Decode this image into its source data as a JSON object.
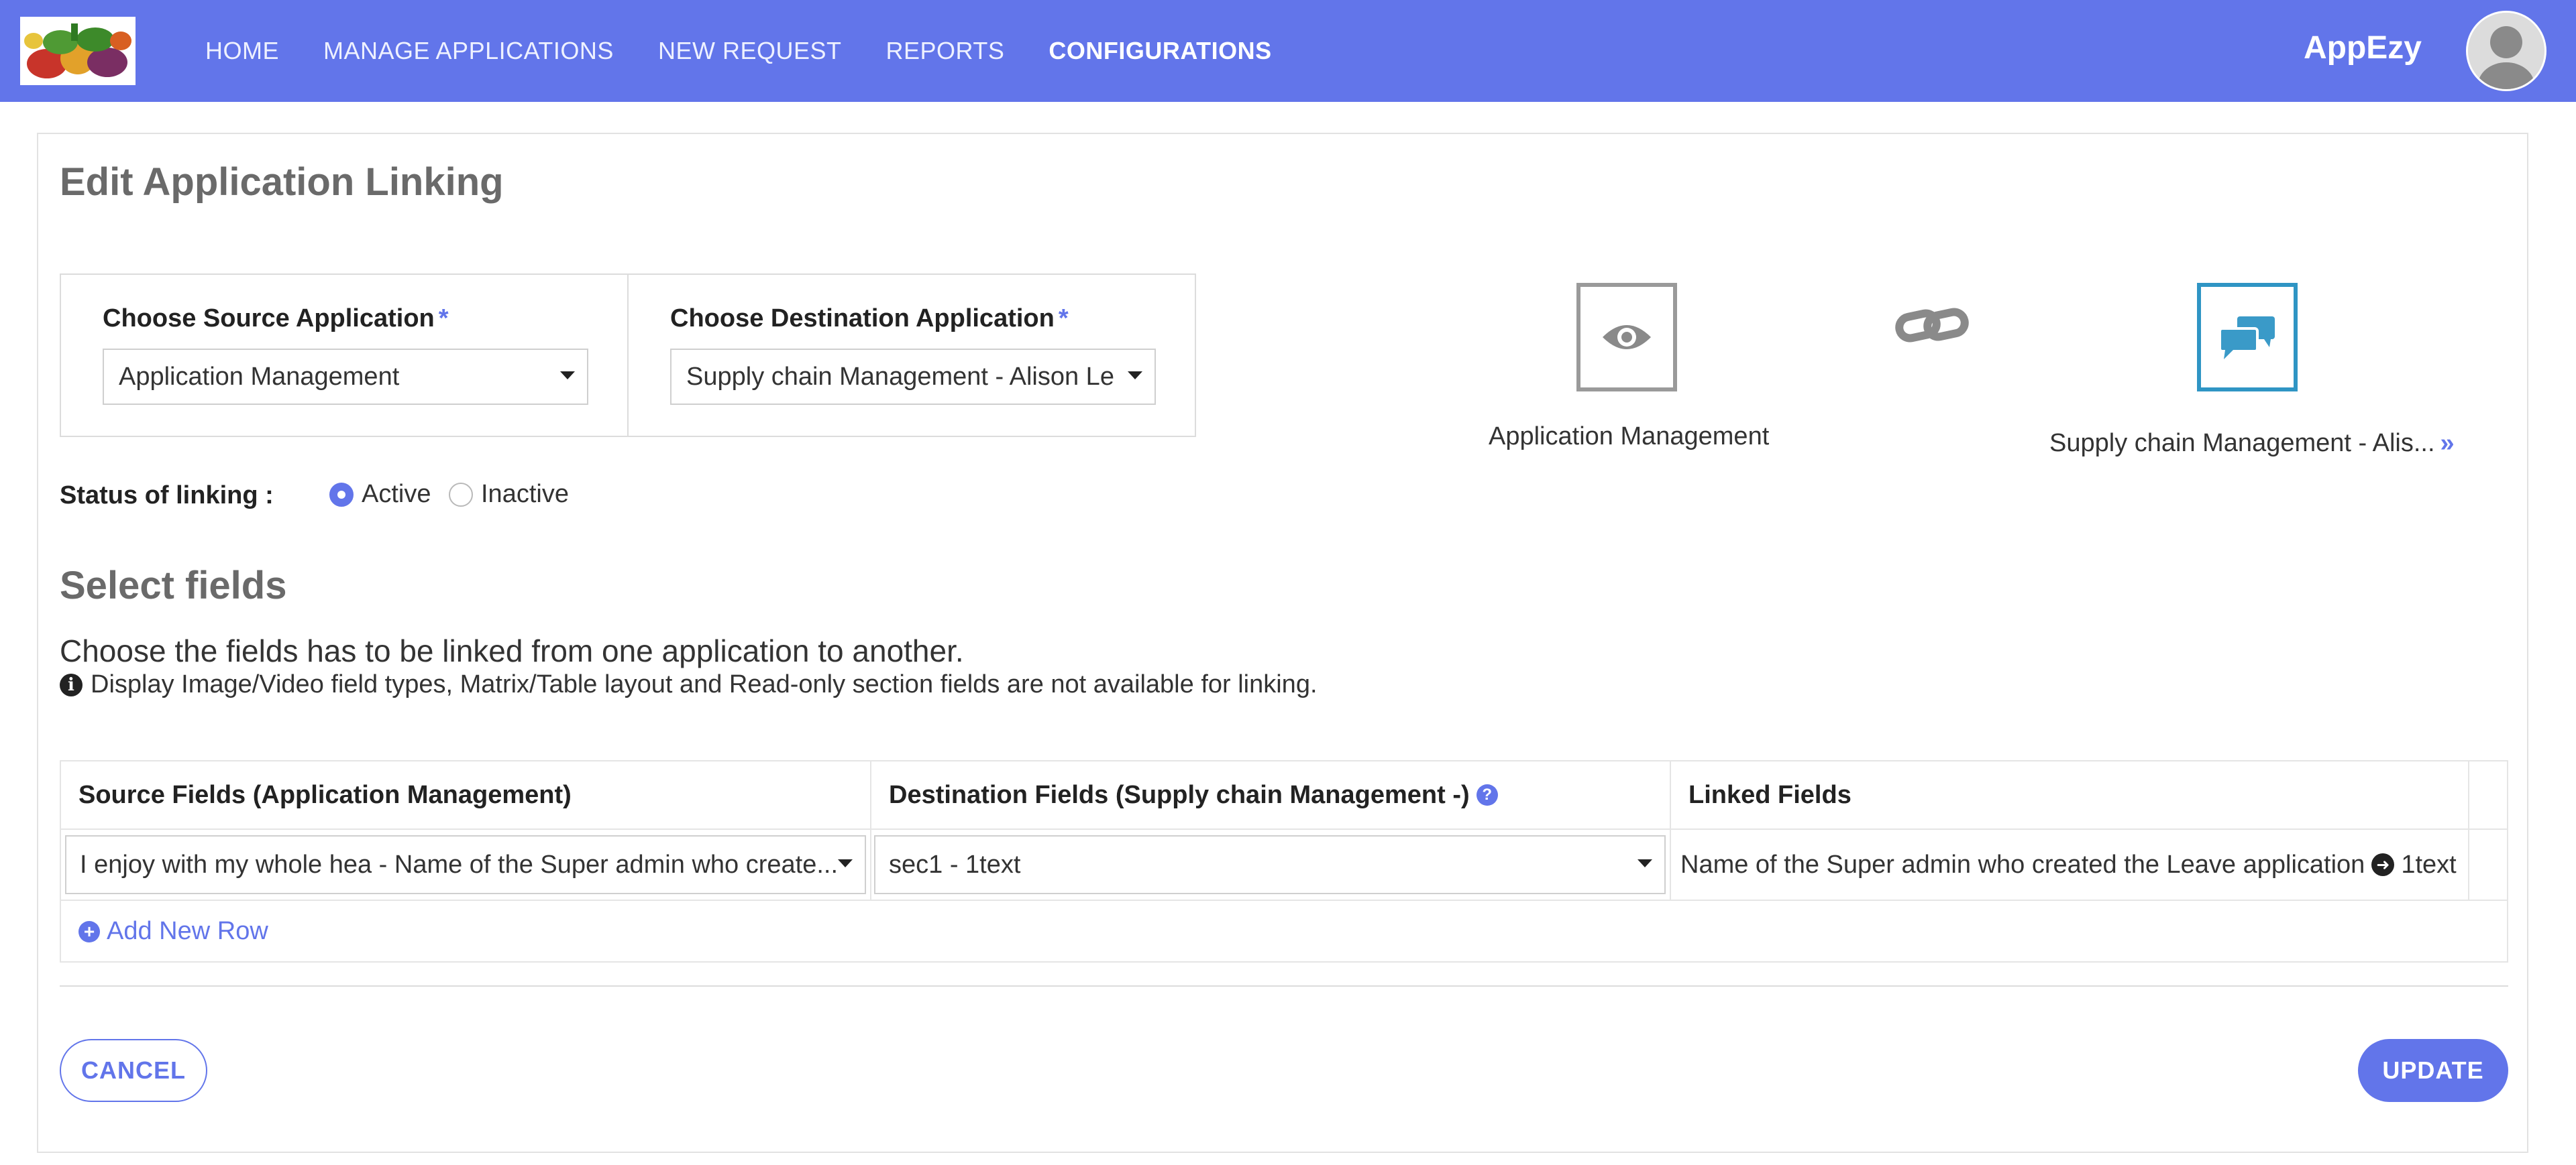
{
  "header": {
    "logo_alt": "vegetables logo",
    "nav": [
      {
        "label": "HOME",
        "active": false
      },
      {
        "label": "MANAGE APPLICATIONS",
        "active": false
      },
      {
        "label": "NEW REQUEST",
        "active": false
      },
      {
        "label": "REPORTS",
        "active": false
      },
      {
        "label": "CONFIGURATIONS",
        "active": true
      }
    ],
    "app_name": "AppEzy",
    "accent_color": "#6275ea"
  },
  "page": {
    "title": "Edit Application Linking"
  },
  "source": {
    "label": "Choose Source Application",
    "required_mark": "*",
    "selected": "Application Management"
  },
  "destination": {
    "label": "Choose Destination Application",
    "required_mark": "*",
    "selected": "Supply chain Management - Alison Le"
  },
  "visual": {
    "source_icon": "eye-icon",
    "source_name": "Application Management",
    "link_icon": "chain-link-icon",
    "destination_icon": "chat-bubbles-icon",
    "destination_name": "Supply chain Management - Alis...",
    "more_icon": "»"
  },
  "status": {
    "label": "Status of linking :",
    "options": [
      {
        "label": "Active",
        "checked": true
      },
      {
        "label": "Inactive",
        "checked": false
      }
    ]
  },
  "fields": {
    "title": "Select fields",
    "description": "Choose the fields has to be linked from one application to another.",
    "note": "Display Image/Video field types, Matrix/Table layout and Read-only section fields are not available for linking.",
    "columns": {
      "source": "Source Fields (Application Management)",
      "destination": "Destination Fields (Supply chain Management -)",
      "linked": "Linked Fields"
    },
    "rows": [
      {
        "source": "I enjoy with my whole hea - Name of the Super admin who create...",
        "destination": "sec1 - 1text",
        "linked_source": "Name of the Super admin who created the Leave application",
        "linked_destination": "1text"
      }
    ],
    "add_row_label": "Add New Row"
  },
  "actions": {
    "cancel": "CANCEL",
    "update": "UPDATE"
  }
}
